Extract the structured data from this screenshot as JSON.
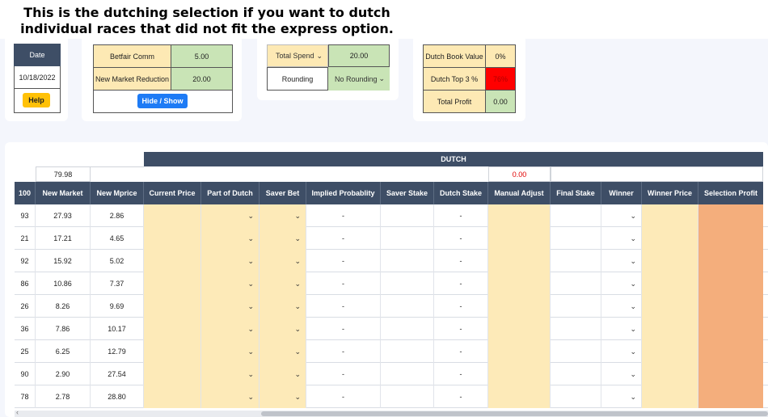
{
  "caption": {
    "line1": "This is the dutching selection if you want to dutch",
    "line2": "individual races that did not fit the express option."
  },
  "date_panel": {
    "header": "Date",
    "value": "10/18/2022",
    "help_label": "Help"
  },
  "comm_panel": {
    "betfair_comm_label": "Betfair Comm",
    "betfair_comm_value": "5.00",
    "new_market_reduction_label": "New Market Reduction",
    "new_market_reduction_value": "20.00",
    "hide_show_label": "Hide / Show"
  },
  "spend_panel": {
    "total_spend_select": "Total Spend",
    "total_spend_value": "20.00",
    "rounding_label": "Rounding",
    "rounding_select": "No Rounding"
  },
  "dutch_panel": {
    "book_value_label": "Dutch Book Value",
    "book_value": "0%",
    "top3_label": "Dutch Top 3 %",
    "top3_value": "76%",
    "total_profit_label": "Total Profit",
    "total_profit_value": "0.00"
  },
  "table": {
    "group_header": "DUTCH",
    "summary_new_market": "79.98",
    "summary_manual_adjust": "0.00",
    "columns": [
      "100",
      "New Market",
      "New Mprice",
      "Current Price",
      "Part of Dutch",
      "Saver Bet",
      "Implied Probablity",
      "Saver Stake",
      "Dutch Stake",
      "Manual Adjust",
      "Final Stake",
      "Winner",
      "Winner Price",
      "Selection Profit"
    ],
    "rows": [
      {
        "c0": "93",
        "new_market": "27.93",
        "new_mprice": "2.86",
        "implied": "-",
        "dutch_stake": "-"
      },
      {
        "c0": "21",
        "new_market": "17.21",
        "new_mprice": "4.65",
        "implied": "-",
        "dutch_stake": "-"
      },
      {
        "c0": "92",
        "new_market": "15.92",
        "new_mprice": "5.02",
        "implied": "-",
        "dutch_stake": "-"
      },
      {
        "c0": "86",
        "new_market": "10.86",
        "new_mprice": "7.37",
        "implied": "-",
        "dutch_stake": "-"
      },
      {
        "c0": "26",
        "new_market": "8.26",
        "new_mprice": "9.69",
        "implied": "-",
        "dutch_stake": "-"
      },
      {
        "c0": "36",
        "new_market": "7.86",
        "new_mprice": "10.17",
        "implied": "-",
        "dutch_stake": "-"
      },
      {
        "c0": "25",
        "new_market": "6.25",
        "new_mprice": "12.79",
        "implied": "-",
        "dutch_stake": "-"
      },
      {
        "c0": "90",
        "new_market": "2.90",
        "new_mprice": "27.54",
        "implied": "-",
        "dutch_stake": "-"
      },
      {
        "c0": "78",
        "new_market": "2.78",
        "new_mprice": "28.80",
        "implied": "-",
        "dutch_stake": "-"
      }
    ]
  },
  "icons": {
    "dropdown": "chevron-down-icon",
    "scroll_left": "chevron-left-icon"
  },
  "colors": {
    "header_navy": "#3e4e66",
    "input_yellow": "#fde9b4",
    "value_green": "#c9e4b6",
    "alert_red": "#ff0000",
    "profit_orange": "#f4ae7c",
    "help_yellow": "#ffc107",
    "button_blue": "#1e7bf5"
  }
}
